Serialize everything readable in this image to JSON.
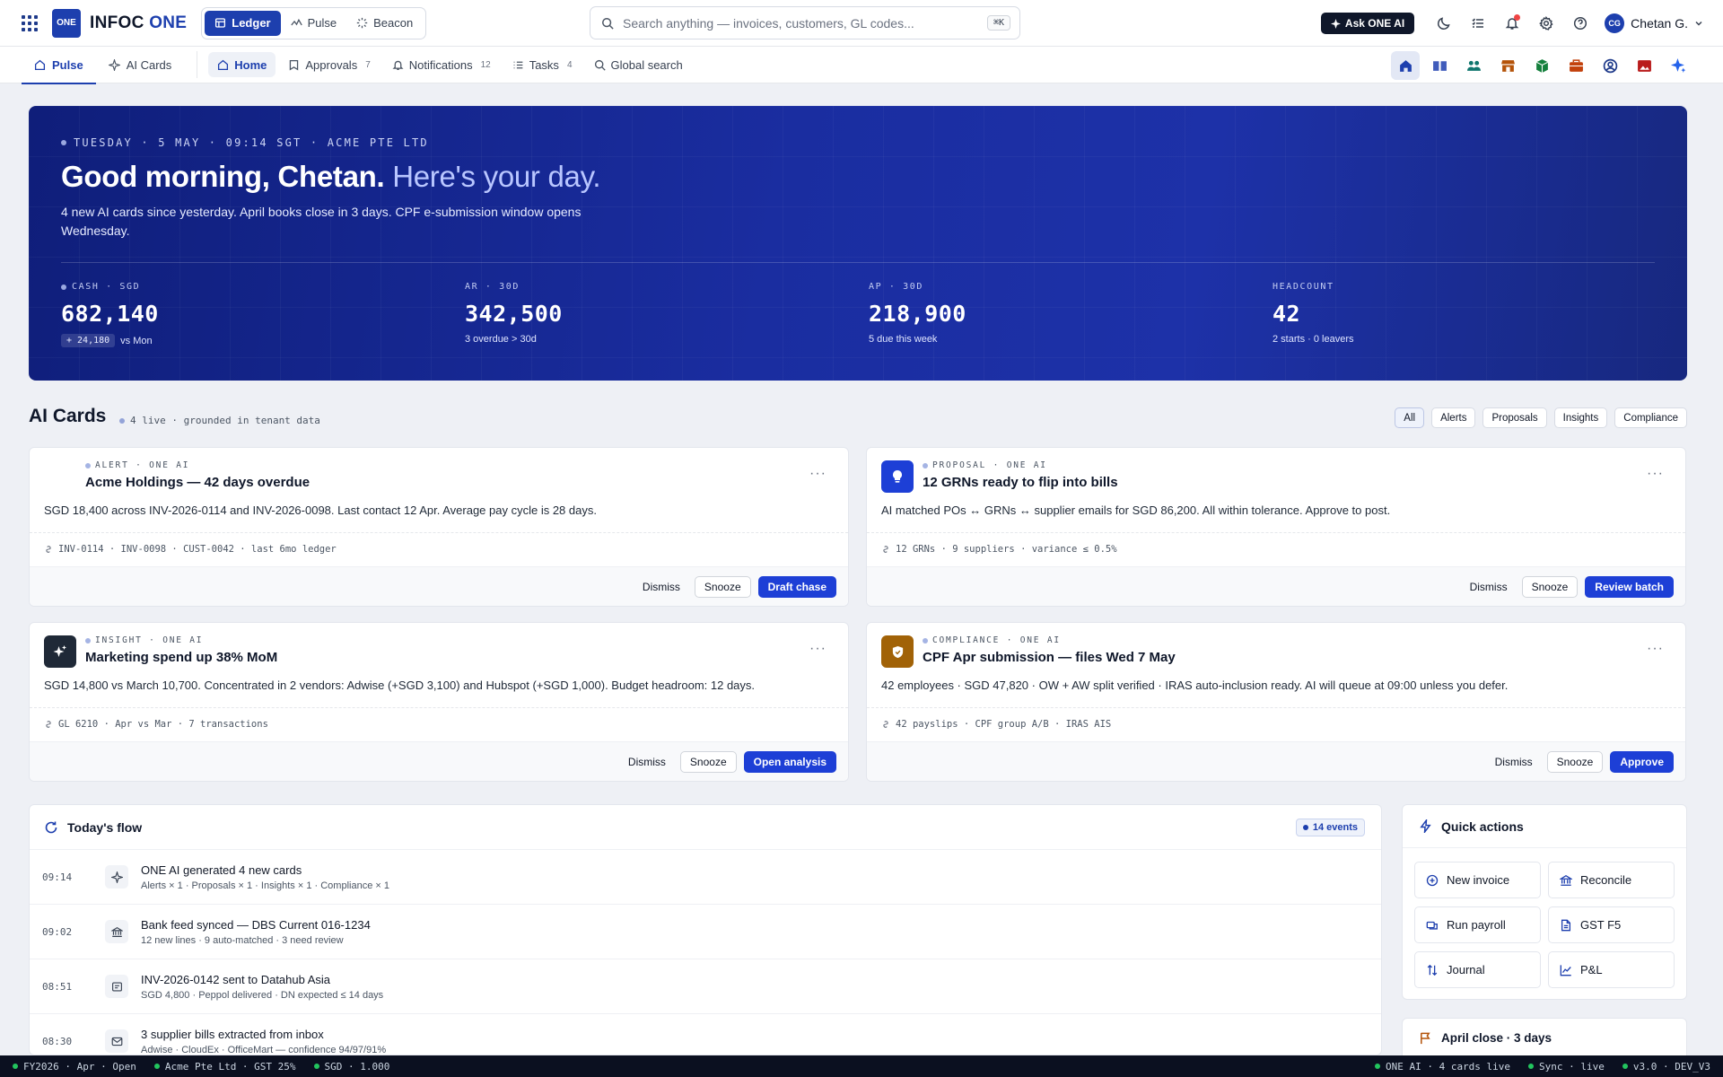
{
  "brand": {
    "logo_box": "ONE",
    "name_main": "INFOC ",
    "name_accent": "ONE"
  },
  "modes": [
    {
      "label": "Ledger",
      "icon": "ledger-icon"
    },
    {
      "label": "Pulse",
      "icon": "pulse-icon"
    },
    {
      "label": "Beacon",
      "icon": "beacon-icon"
    }
  ],
  "search": {
    "placeholder": "Search anything — invoices, customers, GL codes...",
    "shortcut": "⌘K"
  },
  "topbar": {
    "ask_label": "Ask ONE AI",
    "user_initials": "CG",
    "user_name": "Chetan G."
  },
  "subtabs": [
    {
      "label": "Pulse"
    },
    {
      "label": "AI Cards"
    }
  ],
  "nav": [
    {
      "label": "Home",
      "count": ""
    },
    {
      "label": "Approvals",
      "count": "7"
    },
    {
      "label": "Notifications",
      "count": "12"
    },
    {
      "label": "Tasks",
      "count": "4"
    },
    {
      "label": "Global search",
      "count": ""
    }
  ],
  "hero": {
    "meta": "TUESDAY · 5 MAY · 09:14 SGT · ACME PTE LTD",
    "greeting": "Good morning, Chetan.",
    "greeting_light": "Here's your day.",
    "subtitle": "4 new AI cards since yesterday. April books close in 3 days. CPF e-submission window opens Wednesday.",
    "kpis": [
      {
        "label": "CASH · SGD",
        "value": "682,140",
        "chip": "+ 24,180",
        "note": "vs Mon"
      },
      {
        "label": "AR · 30D",
        "value": "342,500",
        "chip": "",
        "note": "3 overdue > 30d"
      },
      {
        "label": "AP · 30D",
        "value": "218,900",
        "chip": "",
        "note": "5 due this week"
      },
      {
        "label": "HEADCOUNT",
        "value": "42",
        "chip": "",
        "note": "2 starts · 0 leavers"
      }
    ]
  },
  "ai_cards": {
    "title": "AI Cards",
    "meta": "4 live · grounded in tenant data",
    "filters": [
      "All",
      "Alerts",
      "Proposals",
      "Insights",
      "Compliance"
    ],
    "cards": [
      {
        "kicker": "ALERT · ONE AI",
        "title": "Acme Holdings — 42 days overdue",
        "body": "SGD 18,400 across INV-2026-0114 and INV-2026-0098. Last contact 12 Apr. Average pay cycle is 28 days.",
        "refs": "INV-0114 · INV-0098 · CUST-0042 · last 6mo ledger",
        "dismiss": "Dismiss",
        "snooze": "Snooze",
        "primary": "Draft chase"
      },
      {
        "kicker": "PROPOSAL · ONE AI",
        "title": "12 GRNs ready to flip into bills",
        "body": "AI matched POs ↔ GRNs ↔ supplier emails for SGD 86,200. All within tolerance. Approve to post.",
        "refs": "12 GRNs · 9 suppliers · variance ≤ 0.5%",
        "dismiss": "Dismiss",
        "snooze": "Snooze",
        "primary": "Review batch"
      },
      {
        "kicker": "INSIGHT · ONE AI",
        "title": "Marketing spend up 38% MoM",
        "body": "SGD 14,800 vs March 10,700. Concentrated in 2 vendors: Adwise (+SGD 3,100) and Hubspot (+SGD 1,000). Budget headroom: 12 days.",
        "refs": "GL 6210 · Apr vs Mar · 7 transactions",
        "dismiss": "Dismiss",
        "snooze": "Snooze",
        "primary": "Open analysis"
      },
      {
        "kicker": "COMPLIANCE · ONE AI",
        "title": "CPF Apr submission — files Wed 7 May",
        "body": "42 employees · SGD 47,820 · OW + AW split verified · IRAS auto-inclusion ready. AI will queue at 09:00 unless you defer.",
        "refs": "42 payslips · CPF group A/B · IRAS AIS",
        "dismiss": "Dismiss",
        "snooze": "Snooze",
        "primary": "Approve"
      }
    ]
  },
  "flow": {
    "title": "Today's flow",
    "badge": "14 events",
    "rows": [
      {
        "time": "09:14",
        "icon": "sparkle-icon",
        "title": "ONE AI generated 4 new cards",
        "sub": "Alerts × 1 · Proposals × 1 · Insights × 1 · Compliance × 1"
      },
      {
        "time": "09:02",
        "icon": "bank-icon",
        "title": "Bank feed synced — DBS Current 016-1234",
        "sub": "12 new lines · 9 auto-matched · 3 need review"
      },
      {
        "time": "08:51",
        "icon": "invoice-icon",
        "title": "INV-2026-0142 sent to Datahub Asia",
        "sub": "SGD 4,800 · Peppol delivered · DN expected ≤ 14 days"
      },
      {
        "time": "08:30",
        "icon": "mail-icon",
        "title": "3 supplier bills extracted from inbox",
        "sub": "Adwise · CloudEx · OfficeMart — confidence 94/97/91%"
      }
    ]
  },
  "quick_actions": {
    "title": "Quick actions",
    "items": [
      {
        "label": "New invoice",
        "icon": "plus-circle-icon"
      },
      {
        "label": "Reconcile",
        "icon": "bank-icon"
      },
      {
        "label": "Run payroll",
        "icon": "payroll-icon"
      },
      {
        "label": "GST F5",
        "icon": "document-icon"
      },
      {
        "label": "Journal",
        "icon": "journal-icon"
      },
      {
        "label": "P&L",
        "icon": "chart-icon"
      }
    ]
  },
  "close_card": {
    "title": "April close · 3 days"
  },
  "statusbar": {
    "left": [
      "FY2026 · Apr · Open",
      "Acme Pte Ltd · GST 25%",
      "SGD · 1.000"
    ],
    "right": [
      "ONE AI · 4 cards live",
      "Sync · live",
      "v3.0 · DEV_V3"
    ]
  },
  "colors": {
    "brand": "#1d3fae",
    "primary_button": "#1d3fd6",
    "hero_start": "#0f1e7a",
    "hero_end": "#17287f",
    "status_ok": "#22c55e",
    "alert_red": "#ef4444",
    "compliance_gold": "#a16207"
  }
}
